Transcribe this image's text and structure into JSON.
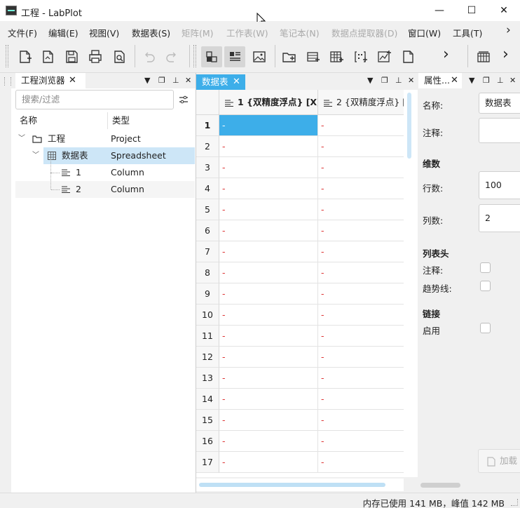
{
  "window": {
    "title": "工程 - LabPlot",
    "minimize": "—",
    "maximize": "☐",
    "close": "✕"
  },
  "menu": [
    {
      "label": "文件(F)",
      "enabled": true
    },
    {
      "label": "编辑(E)",
      "enabled": true
    },
    {
      "label": "视图(V)",
      "enabled": true
    },
    {
      "label": "数据表(S)",
      "enabled": true
    },
    {
      "label": "矩阵(M)",
      "enabled": false
    },
    {
      "label": "工作表(W)",
      "enabled": false
    },
    {
      "label": "笔记本(N)",
      "enabled": false
    },
    {
      "label": "数据点提取器(D)",
      "enabled": false
    },
    {
      "label": "窗口(W)",
      "enabled": true
    },
    {
      "label": "工具(T)",
      "enabled": true
    }
  ],
  "menu_more": "›",
  "toolbar": {
    "icons": [
      "new-file-icon",
      "open-file-icon",
      "save-icon",
      "print-icon",
      "print-preview-icon",
      "undo-icon",
      "redo-icon",
      "tile-view-icon",
      "list-view-icon",
      "image-icon",
      "new-folder-icon",
      "new-datasource-icon",
      "new-spreadsheet-icon",
      "new-matrix-icon",
      "new-worksheet-icon",
      "new-note-icon"
    ],
    "more": "›"
  },
  "project_explorer": {
    "title": "工程浏览器",
    "search_placeholder": "搜索/过滤",
    "col_name": "名称",
    "col_type": "类型",
    "rows": [
      {
        "name": "工程",
        "type": "Project"
      },
      {
        "name": "数据表",
        "type": "Spreadsheet"
      },
      {
        "name": "1",
        "type": "Column"
      },
      {
        "name": "2",
        "type": "Column"
      }
    ]
  },
  "spreadsheet": {
    "tab": "数据表",
    "columns": [
      "1 {双精度浮点} [X]",
      "2 {双精度浮点} [Y"
    ],
    "rows": [
      "1",
      "2",
      "3",
      "4",
      "5",
      "6",
      "7",
      "8",
      "9",
      "10",
      "11",
      "12",
      "13",
      "14",
      "15",
      "16",
      "17"
    ],
    "empty_value": "-"
  },
  "properties": {
    "title": "属性...",
    "name_label": "名称:",
    "name_value": "数据表",
    "comment_label": "注释:",
    "dimension_header": "维数",
    "rows_label": "行数:",
    "rows_value": "100",
    "cols_label": "列数:",
    "cols_value": "2",
    "header_section": "列表头",
    "header_comment_label": "注释:",
    "header_sparkline_label": "趋势线:",
    "link_section": "链接",
    "enable_label": "启用",
    "load_button": "加载"
  },
  "status": {
    "memory": "内存已使用 141 MB，峰值 142 MB"
  }
}
